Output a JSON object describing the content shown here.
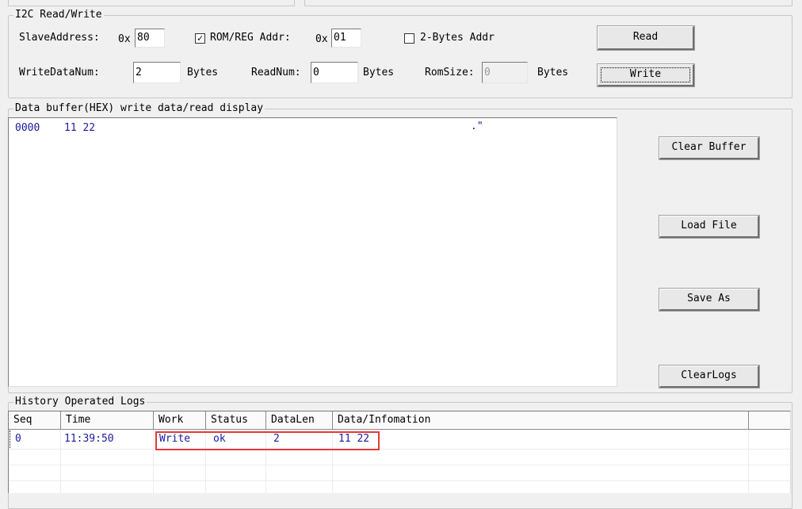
{
  "i2c": {
    "group_title": "I2C Read/Write",
    "slave_label": "SlaveAddress:",
    "hex_prefix": "0x",
    "slave_value": "80",
    "rom_reg_checked_mark": "✓",
    "rom_reg_label": "ROM/REG Addr:",
    "rom_reg_value": "01",
    "two_bytes_label": "2-Bytes Addr",
    "read_button": "Read",
    "write_num_label": "WriteDataNum:",
    "write_num_value": "2",
    "bytes_label": "Bytes",
    "read_num_label": "ReadNum:",
    "read_num_value": "0",
    "rom_size_label": "RomSize:",
    "rom_size_value": "0",
    "write_button": "Write"
  },
  "buffer": {
    "group_title": "Data buffer(HEX) write data/read display",
    "line_offset": "0000",
    "line_hex": "11 22",
    "line_ascii": ".\"",
    "clear_buffer_button": "Clear Buffer",
    "load_file_button": "Load File",
    "save_as_button": "Save As",
    "clear_logs_button": "ClearLogs"
  },
  "logs": {
    "group_title": "History Operated Logs",
    "columns": [
      "Seq",
      "Time",
      "Work",
      "Status",
      "DataLen",
      "Data/Infomation"
    ],
    "rows": [
      {
        "seq": "0",
        "time": "11:39:50",
        "work": "Write",
        "status": "ok",
        "datalen": "2",
        "data": "11 22"
      }
    ],
    "highlight_color": "#e53935"
  }
}
